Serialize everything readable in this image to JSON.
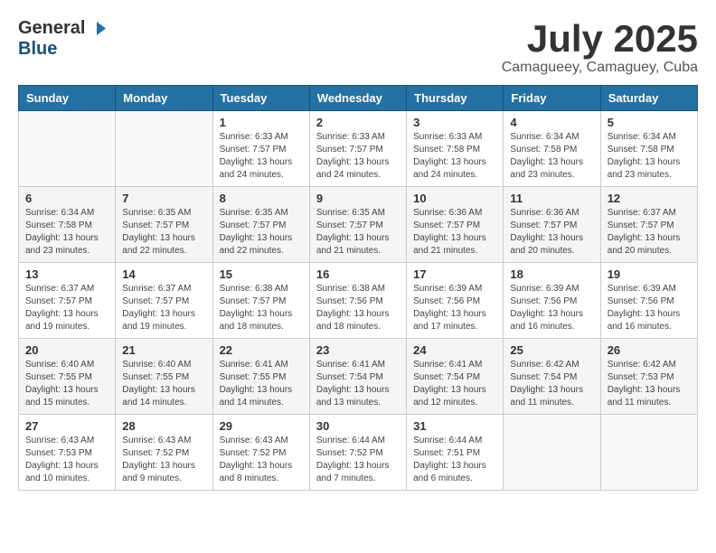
{
  "header": {
    "logo_general": "General",
    "logo_blue": "Blue",
    "month_title": "July 2025",
    "subtitle": "Camagueey, Camaguey, Cuba"
  },
  "days_of_week": [
    "Sunday",
    "Monday",
    "Tuesday",
    "Wednesday",
    "Thursday",
    "Friday",
    "Saturday"
  ],
  "weeks": [
    [
      {
        "day": "",
        "info": ""
      },
      {
        "day": "",
        "info": ""
      },
      {
        "day": "1",
        "info": "Sunrise: 6:33 AM\nSunset: 7:57 PM\nDaylight: 13 hours and 24 minutes."
      },
      {
        "day": "2",
        "info": "Sunrise: 6:33 AM\nSunset: 7:57 PM\nDaylight: 13 hours and 24 minutes."
      },
      {
        "day": "3",
        "info": "Sunrise: 6:33 AM\nSunset: 7:58 PM\nDaylight: 13 hours and 24 minutes."
      },
      {
        "day": "4",
        "info": "Sunrise: 6:34 AM\nSunset: 7:58 PM\nDaylight: 13 hours and 23 minutes."
      },
      {
        "day": "5",
        "info": "Sunrise: 6:34 AM\nSunset: 7:58 PM\nDaylight: 13 hours and 23 minutes."
      }
    ],
    [
      {
        "day": "6",
        "info": "Sunrise: 6:34 AM\nSunset: 7:58 PM\nDaylight: 13 hours and 23 minutes."
      },
      {
        "day": "7",
        "info": "Sunrise: 6:35 AM\nSunset: 7:57 PM\nDaylight: 13 hours and 22 minutes."
      },
      {
        "day": "8",
        "info": "Sunrise: 6:35 AM\nSunset: 7:57 PM\nDaylight: 13 hours and 22 minutes."
      },
      {
        "day": "9",
        "info": "Sunrise: 6:35 AM\nSunset: 7:57 PM\nDaylight: 13 hours and 21 minutes."
      },
      {
        "day": "10",
        "info": "Sunrise: 6:36 AM\nSunset: 7:57 PM\nDaylight: 13 hours and 21 minutes."
      },
      {
        "day": "11",
        "info": "Sunrise: 6:36 AM\nSunset: 7:57 PM\nDaylight: 13 hours and 20 minutes."
      },
      {
        "day": "12",
        "info": "Sunrise: 6:37 AM\nSunset: 7:57 PM\nDaylight: 13 hours and 20 minutes."
      }
    ],
    [
      {
        "day": "13",
        "info": "Sunrise: 6:37 AM\nSunset: 7:57 PM\nDaylight: 13 hours and 19 minutes."
      },
      {
        "day": "14",
        "info": "Sunrise: 6:37 AM\nSunset: 7:57 PM\nDaylight: 13 hours and 19 minutes."
      },
      {
        "day": "15",
        "info": "Sunrise: 6:38 AM\nSunset: 7:57 PM\nDaylight: 13 hours and 18 minutes."
      },
      {
        "day": "16",
        "info": "Sunrise: 6:38 AM\nSunset: 7:56 PM\nDaylight: 13 hours and 18 minutes."
      },
      {
        "day": "17",
        "info": "Sunrise: 6:39 AM\nSunset: 7:56 PM\nDaylight: 13 hours and 17 minutes."
      },
      {
        "day": "18",
        "info": "Sunrise: 6:39 AM\nSunset: 7:56 PM\nDaylight: 13 hours and 16 minutes."
      },
      {
        "day": "19",
        "info": "Sunrise: 6:39 AM\nSunset: 7:56 PM\nDaylight: 13 hours and 16 minutes."
      }
    ],
    [
      {
        "day": "20",
        "info": "Sunrise: 6:40 AM\nSunset: 7:55 PM\nDaylight: 13 hours and 15 minutes."
      },
      {
        "day": "21",
        "info": "Sunrise: 6:40 AM\nSunset: 7:55 PM\nDaylight: 13 hours and 14 minutes."
      },
      {
        "day": "22",
        "info": "Sunrise: 6:41 AM\nSunset: 7:55 PM\nDaylight: 13 hours and 14 minutes."
      },
      {
        "day": "23",
        "info": "Sunrise: 6:41 AM\nSunset: 7:54 PM\nDaylight: 13 hours and 13 minutes."
      },
      {
        "day": "24",
        "info": "Sunrise: 6:41 AM\nSunset: 7:54 PM\nDaylight: 13 hours and 12 minutes."
      },
      {
        "day": "25",
        "info": "Sunrise: 6:42 AM\nSunset: 7:54 PM\nDaylight: 13 hours and 11 minutes."
      },
      {
        "day": "26",
        "info": "Sunrise: 6:42 AM\nSunset: 7:53 PM\nDaylight: 13 hours and 11 minutes."
      }
    ],
    [
      {
        "day": "27",
        "info": "Sunrise: 6:43 AM\nSunset: 7:53 PM\nDaylight: 13 hours and 10 minutes."
      },
      {
        "day": "28",
        "info": "Sunrise: 6:43 AM\nSunset: 7:52 PM\nDaylight: 13 hours and 9 minutes."
      },
      {
        "day": "29",
        "info": "Sunrise: 6:43 AM\nSunset: 7:52 PM\nDaylight: 13 hours and 8 minutes."
      },
      {
        "day": "30",
        "info": "Sunrise: 6:44 AM\nSunset: 7:52 PM\nDaylight: 13 hours and 7 minutes."
      },
      {
        "day": "31",
        "info": "Sunrise: 6:44 AM\nSunset: 7:51 PM\nDaylight: 13 hours and 6 minutes."
      },
      {
        "day": "",
        "info": ""
      },
      {
        "day": "",
        "info": ""
      }
    ]
  ]
}
